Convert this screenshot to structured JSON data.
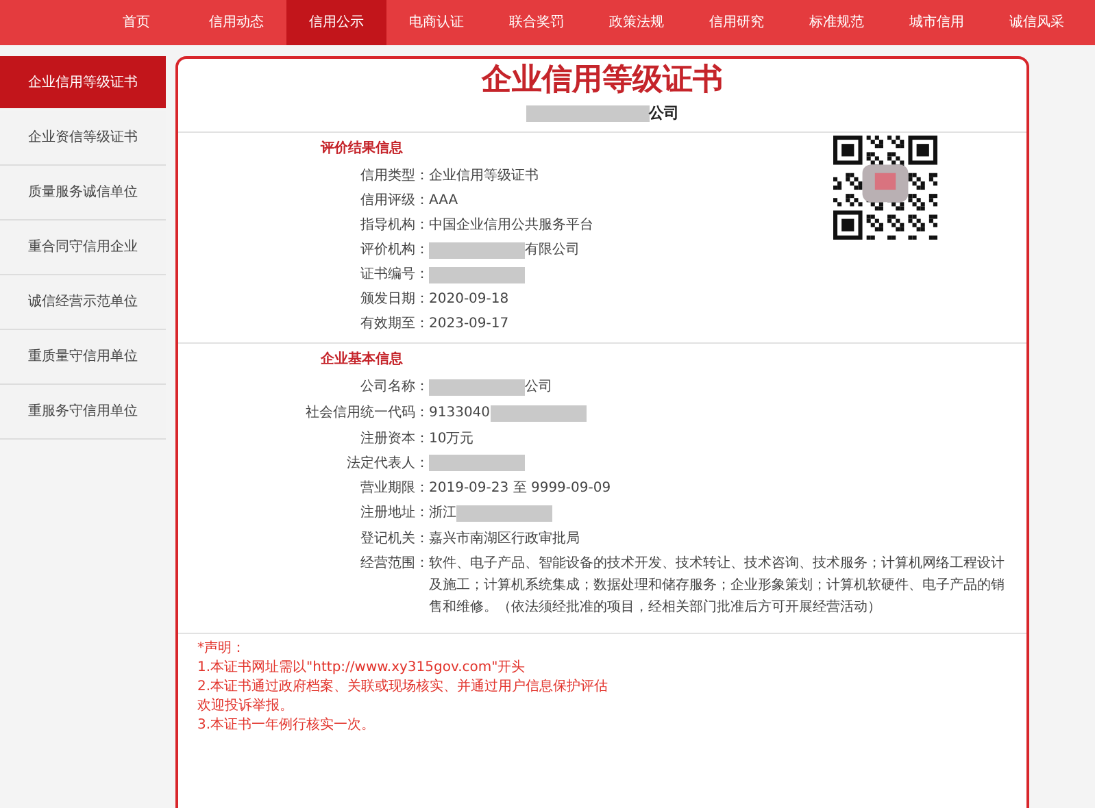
{
  "nav": [
    {
      "label": "首页",
      "selected": false
    },
    {
      "label": "信用动态",
      "selected": false
    },
    {
      "label": "信用公示",
      "selected": true
    },
    {
      "label": "电商认证",
      "selected": false
    },
    {
      "label": "联合奖罚",
      "selected": false
    },
    {
      "label": "政策法规",
      "selected": false
    },
    {
      "label": "信用研究",
      "selected": false
    },
    {
      "label": "标准规范",
      "selected": false
    },
    {
      "label": "城市信用",
      "selected": false
    },
    {
      "label": "诚信风采",
      "selected": false
    }
  ],
  "sidebar": {
    "items": [
      {
        "label": "企业信用等级证书",
        "selected": true
      },
      {
        "label": "企业资信等级证书",
        "selected": false
      },
      {
        "label": "质量服务诚信单位",
        "selected": false
      },
      {
        "label": "重合同守信用企业",
        "selected": false
      },
      {
        "label": "诚信经营示范单位",
        "selected": false
      },
      {
        "label": "重质量守信用单位",
        "selected": false
      },
      {
        "label": "重服务守信用单位",
        "selected": false
      }
    ]
  },
  "certificate": {
    "title": "企业信用等级证书",
    "company": {
      "parts": [
        {
          "kind": "blur"
        },
        {
          "kind": "text",
          "text": "公司"
        }
      ]
    },
    "sections": [
      {
        "heading": "评价结果信息",
        "fields": [
          {
            "label": "信用类型：",
            "value": "企业信用等级证书"
          },
          {
            "label": "信用评级：",
            "value": "AAA"
          },
          {
            "label": "指导机构：",
            "value": "中国企业信用公共服务平台"
          },
          {
            "label": "评价机构：",
            "parts": [
              {
                "kind": "blur"
              },
              {
                "kind": "text",
                "text": "有限公司"
              }
            ]
          },
          {
            "label": "证书编号：",
            "parts": [
              {
                "kind": "blur"
              }
            ]
          },
          {
            "label": "颁发日期：",
            "value": "2020-09-18"
          },
          {
            "label": "有效期至：",
            "value": "2023-09-17"
          }
        ]
      },
      {
        "heading": "企业基本信息",
        "fields": [
          {
            "label": "公司名称：",
            "parts": [
              {
                "kind": "blur"
              },
              {
                "kind": "text",
                "text": "公司"
              }
            ]
          },
          {
            "label": "社会信用统一代码：",
            "parts": [
              {
                "kind": "text",
                "text": "9133040"
              },
              {
                "kind": "blur"
              }
            ]
          },
          {
            "label": "注册资本：",
            "value": "10万元"
          },
          {
            "label": "法定代表人：",
            "parts": [
              {
                "kind": "blur"
              }
            ]
          },
          {
            "label": "营业期限：",
            "value": "2019-09-23 至 9999-09-09"
          },
          {
            "label": "注册地址：",
            "parts": [
              {
                "kind": "text",
                "text": "浙江"
              },
              {
                "kind": "blur"
              }
            ]
          },
          {
            "label": "登记机关：",
            "value": "嘉兴市南湖区行政审批局"
          },
          {
            "label": "经营范围：",
            "value": "软件、电子产品、智能设备的技术开发、技术转让、技术咨询、技术服务；计算机网络工程设计及施工；计算机系统集成；数据处理和储存服务；企业形象策划；计算机软硬件、电子产品的销售和维修。（依法须经批准的项目，经相关部门批准后方可开展经营活动）"
          }
        ]
      }
    ],
    "notice": [
      "*声明：",
      "1.本证书网址需以\"http://www.xy315gov.com\"开头",
      "2.本证书通过政府档案、关联或现场核实、并通过用户信息保护评估",
      "欢迎投诉举报。",
      "3.本证书一年例行核实一次。"
    ]
  }
}
